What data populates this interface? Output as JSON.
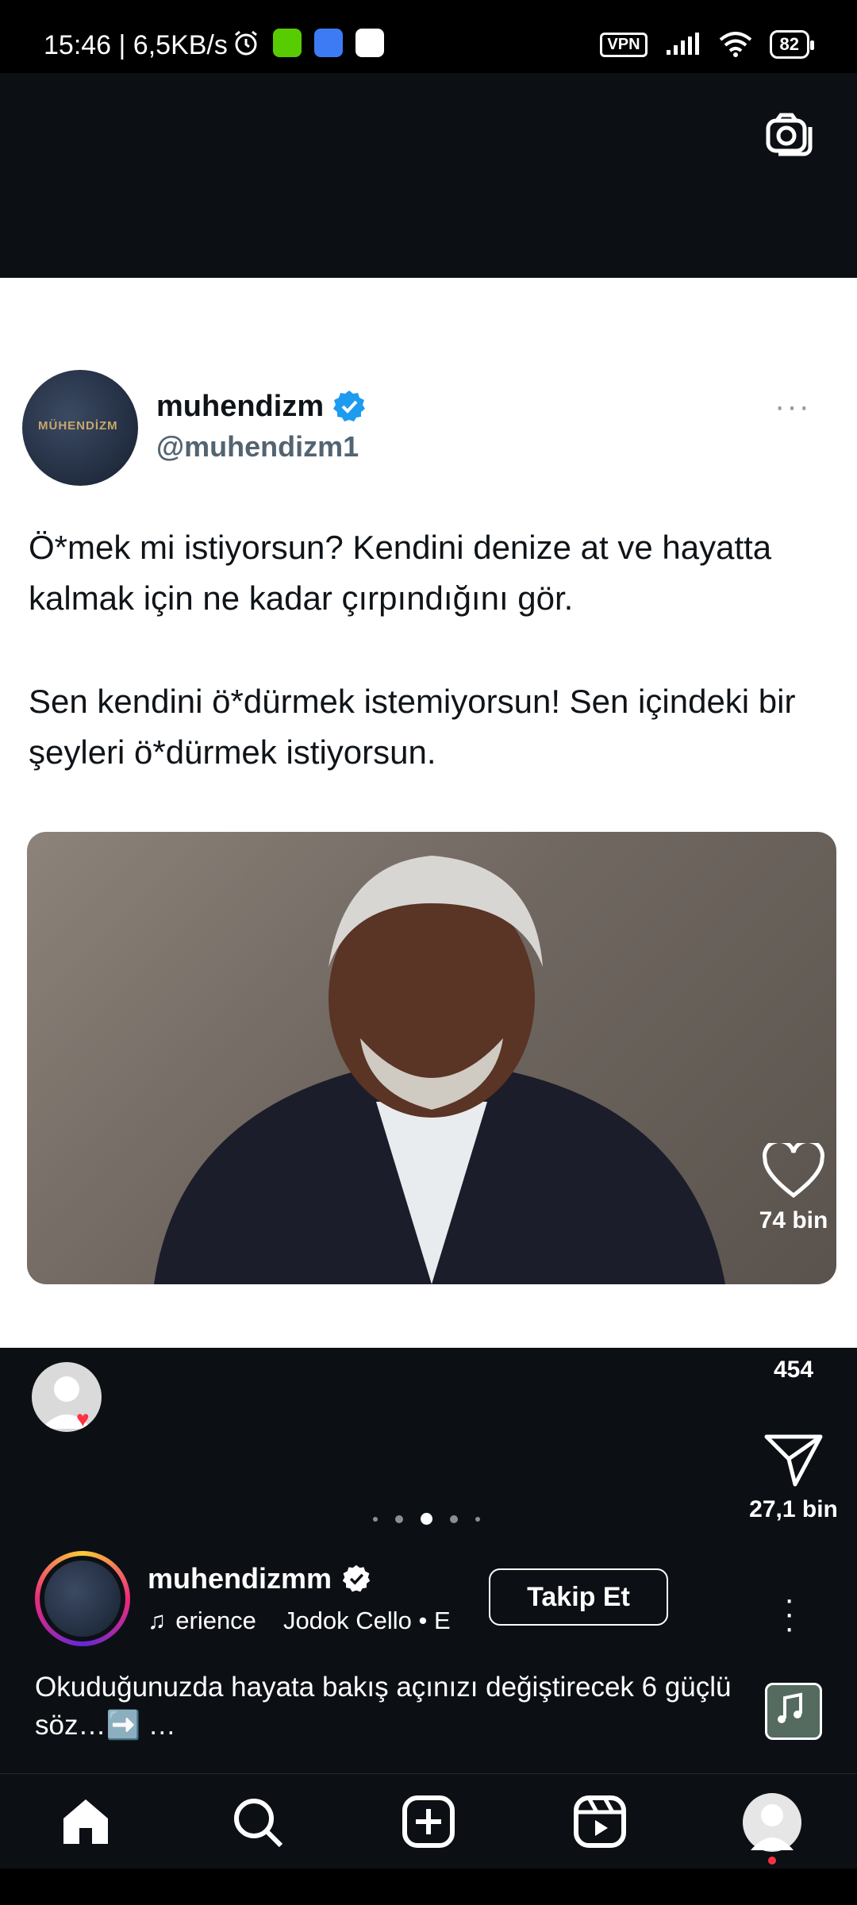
{
  "status_bar": {
    "time_speed": "15:46 | 6,5KB/s",
    "vpn_label": "VPN",
    "battery": "82",
    "app_icon_colors": [
      "#58cc02",
      "#3d7bf5",
      "#ffffff"
    ]
  },
  "tweet": {
    "display_name": "muhendizm",
    "handle": "@muhendizm1",
    "avatar_logo_text": "MÜHENDİZM",
    "more": "···",
    "paragraph_1": "Ö*mek mi istiyorsun? Kendini denize at ve hayatta kalmak için ne kadar çırpındığını gör.",
    "paragraph_2": "Sen kendini ö*dürmek istemiyorsun! Sen içindeki bir şeyleri ö*dürmek istiyorsun."
  },
  "actions": {
    "likes": "74 bin",
    "comments": "454",
    "shares": "27,1 bin"
  },
  "carousel": {
    "total_dots": 5,
    "active_index": 2
  },
  "author": {
    "username": "muhendizmm",
    "music_line_1": "erience",
    "music_line_2": "Jodok Cello • E",
    "follow_label": "Takip Et",
    "caption": "Okuduğunuzda hayata bakış açınızı değiştirecek 6 güçlü söz…➡️ …"
  },
  "nav": {
    "items": [
      "home-icon",
      "search-icon",
      "create-icon",
      "reels-icon",
      "profile-icon"
    ]
  }
}
